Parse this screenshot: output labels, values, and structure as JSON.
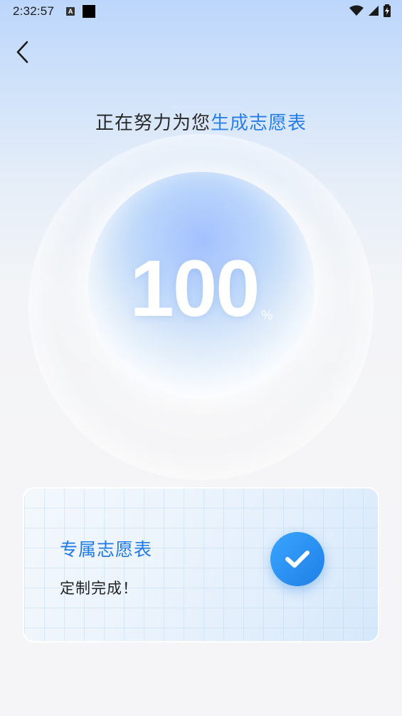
{
  "status_bar": {
    "time": "2:32:57",
    "notification_letter": "A"
  },
  "header": {
    "back_icon": "chevron-left-icon"
  },
  "headline": {
    "prefix": "正在努力为您",
    "highlight": "生成志愿表",
    "highlight_color": "#1f7ae6"
  },
  "progress": {
    "value": "100",
    "unit": "%"
  },
  "result_card": {
    "title": "专属志愿表",
    "subtitle": "定制完成！",
    "check_icon": "check-icon",
    "accent_color": "#1f7ae6"
  }
}
